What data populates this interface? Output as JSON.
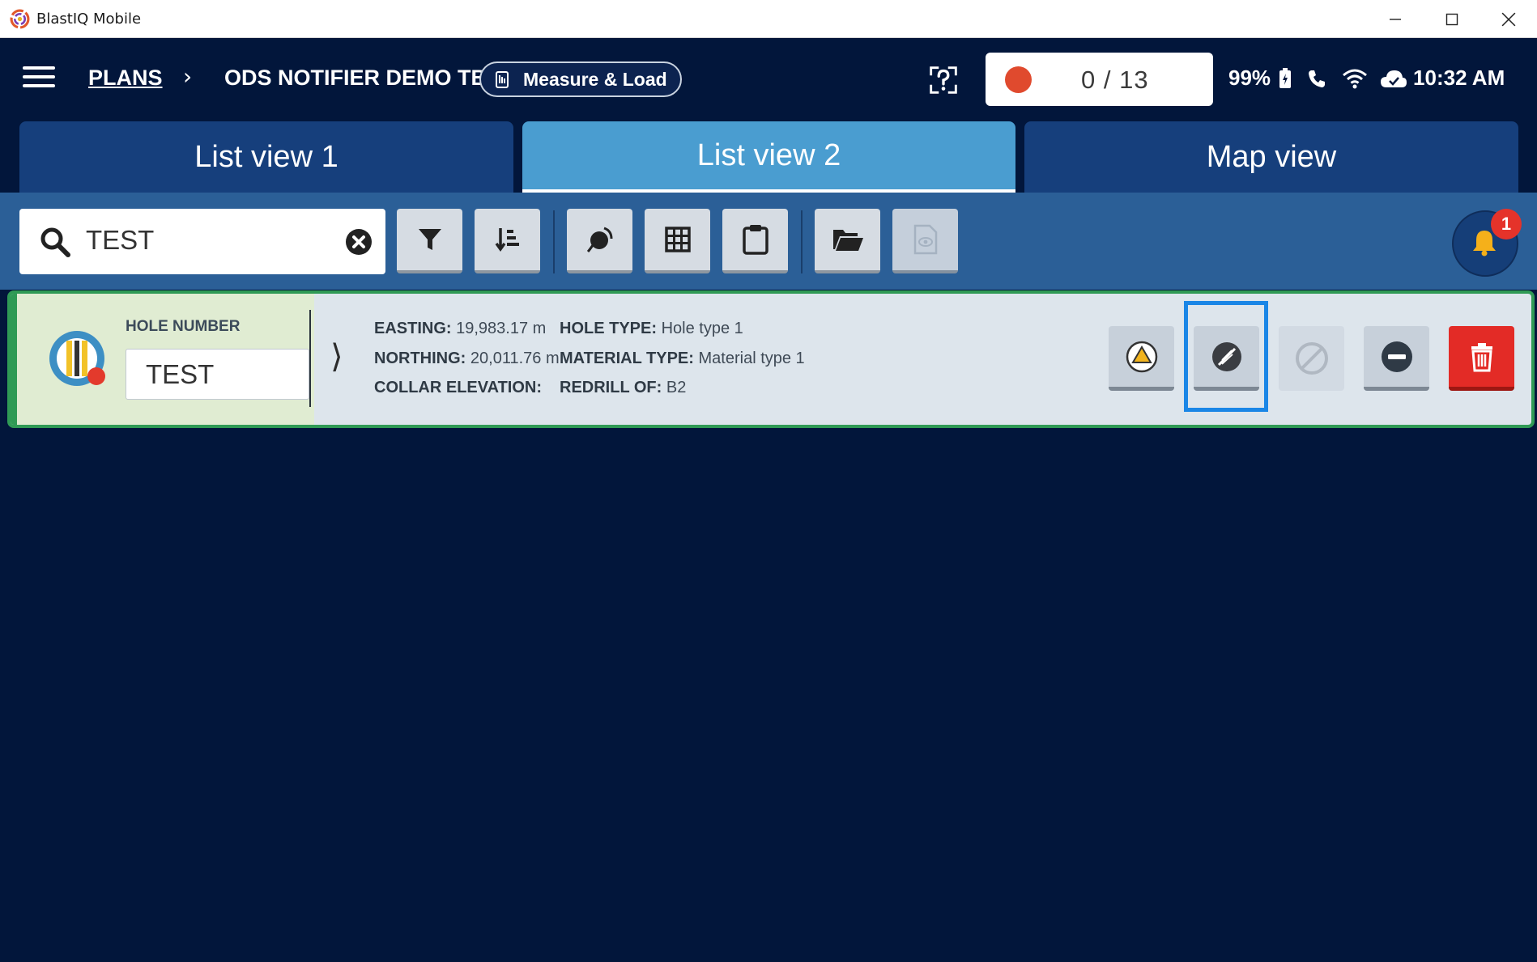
{
  "window": {
    "title": "BlastIQ Mobile"
  },
  "header": {
    "breadcrumb_root": "PLANS",
    "breadcrumb_separator": "›",
    "plan_name": "ODS NOTIFIER DEMO TB",
    "mode_label": "Measure & Load",
    "progress": "0 / 13",
    "battery": "99%",
    "time": "10:32 AM"
  },
  "tabs": [
    {
      "label": "List view 1",
      "active": false
    },
    {
      "label": "List view 2",
      "active": true
    },
    {
      "label": "Map view",
      "active": false
    }
  ],
  "toolbar": {
    "search_value": "TEST",
    "buttons": [
      "filter-icon",
      "sort-icon",
      "marker-icon",
      "grid-icon",
      "clipboard-icon",
      "folder-open-icon",
      "document-view-icon"
    ],
    "notification_count": "1"
  },
  "hole": {
    "label": "HOLE NUMBER",
    "value": "TEST",
    "easting_label": "EASTING:",
    "easting_value": "19,983.17 m",
    "northing_label": "NORTHING:",
    "northing_value": "20,011.76 m",
    "collar_label": "COLLAR ELEVATION:",
    "collar_value": "",
    "hole_type_label": "HOLE TYPE:",
    "hole_type_value": "Hole type 1",
    "material_type_label": "MATERIAL TYPE:",
    "material_type_value": "Material type 1",
    "redrill_label": "REDRILL OF:",
    "redrill_value": "B2"
  },
  "colors": {
    "background": "#02163b",
    "tab_active": "#4a9dd0",
    "tab_inactive": "#163f7c",
    "toolbar": "#2b5f97",
    "card_border": "#2f9a55",
    "delete": "#e32b26",
    "highlight": "#1a86e6"
  }
}
